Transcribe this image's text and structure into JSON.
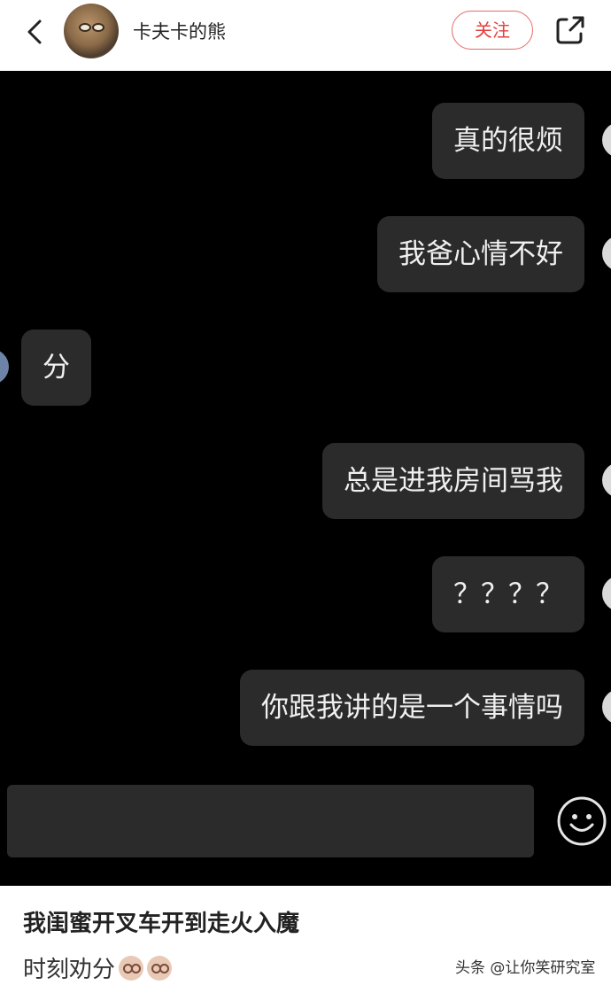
{
  "header": {
    "username": "卡夫卡的熊",
    "follow_label": "关注",
    "back_icon": "chevron-left-icon",
    "share_icon": "share-external-icon"
  },
  "messages": [
    {
      "side": "right",
      "text": "真的很烦"
    },
    {
      "side": "right",
      "text": "我爸心情不好"
    },
    {
      "side": "left",
      "text": "分"
    },
    {
      "side": "right",
      "text": "总是进我房间骂我"
    },
    {
      "side": "right",
      "text": "？？？？"
    },
    {
      "side": "right",
      "text": "你跟我讲的是一个事情吗"
    }
  ],
  "input": {
    "emoji_icon": "smiley-face-icon"
  },
  "caption": {
    "title": "我闺蜜开叉车开到走火入魔",
    "subtitle": "时刻劝分",
    "emoji_icon": "facepalm-emoji-icon"
  },
  "watermark": "头条 @让你笑研究室",
  "colors": {
    "chat_bg": "#000000",
    "bubble_bg": "#2b2b2b",
    "follow_accent": "#e2413f"
  }
}
